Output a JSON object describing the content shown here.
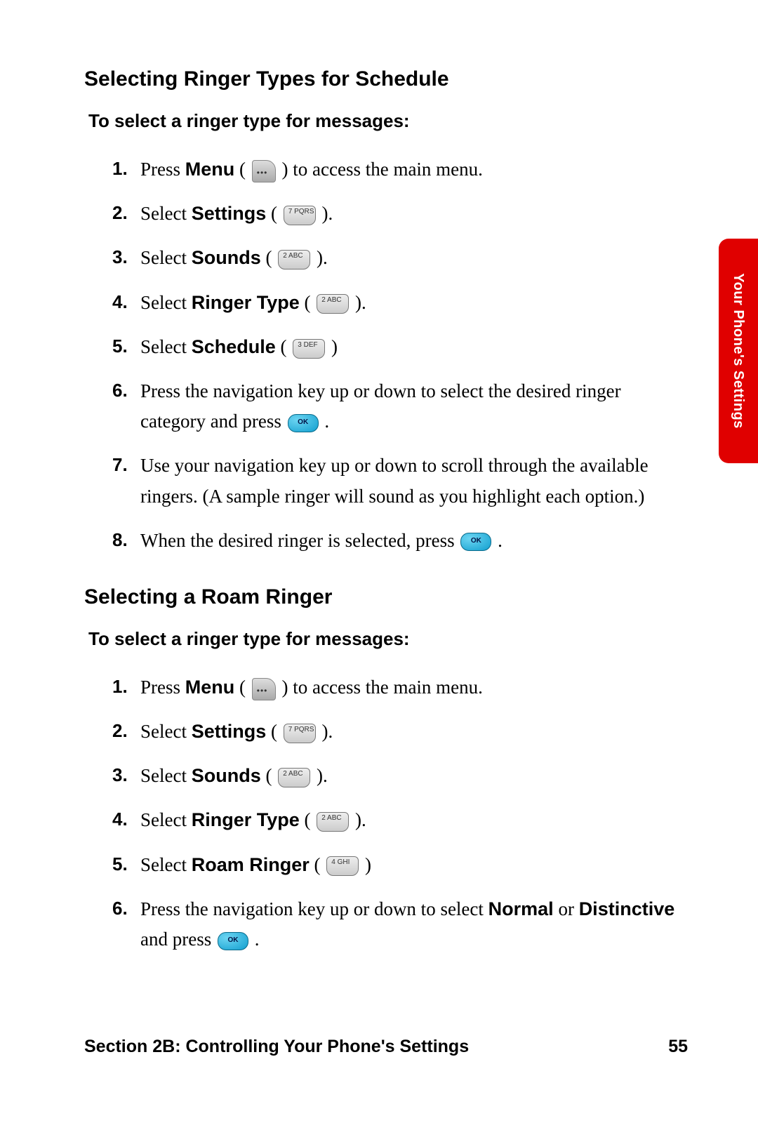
{
  "side_tab": "Your Phone's Settings",
  "section_a": {
    "heading": "Selecting Ringer Types for Schedule",
    "subhead": "To select a ringer type for messages:",
    "steps": {
      "s1_a": "Press ",
      "s1_bold": "Menu",
      "s1_b": " ( ",
      "s1_c": " ) to access the main menu.",
      "s2_a": "Select ",
      "s2_bold": "Settings",
      "s2_b": " ( ",
      "s2_c": " ).",
      "s3_a": "Select ",
      "s3_bold": "Sounds",
      "s3_b": " ( ",
      "s3_c": " ).",
      "s4_a": "Select ",
      "s4_bold": "Ringer Type",
      "s4_b": " ( ",
      "s4_c": " ).",
      "s5_a": "Select ",
      "s5_bold": "Schedule",
      "s5_b": " ( ",
      "s5_c": " )",
      "s6_a": "Press the navigation key up or down to select the desired ringer category and press ",
      "s6_b": " .",
      "s7": "Use your navigation key up or down to scroll through the available ringers. (A sample ringer will sound as you highlight each option.)",
      "s8_a": "When the desired ringer is selected, press ",
      "s8_b": " ."
    }
  },
  "section_b": {
    "heading": "Selecting a Roam Ringer",
    "subhead": "To select a ringer type for messages:",
    "steps": {
      "s1_a": "Press ",
      "s1_bold": "Menu",
      "s1_b": " ( ",
      "s1_c": " ) to access the main menu.",
      "s2_a": "Select ",
      "s2_bold": "Settings",
      "s2_b": " ( ",
      "s2_c": " ).",
      "s3_a": "Select ",
      "s3_bold": "Sounds",
      "s3_b": " ( ",
      "s3_c": " ).",
      "s4_a": "Select ",
      "s4_bold": "Ringer Type",
      "s4_b": " ( ",
      "s4_c": " ).",
      "s5_a": "Select ",
      "s5_bold": "Roam Ringer",
      "s5_b": " ( ",
      "s5_c": " )",
      "s6_a": "Press the navigation key up or down to select ",
      "s6_bold1": "Normal",
      "s6_mid": " or ",
      "s6_bold2": "Distinctive",
      "s6_b": " and press ",
      "s6_c": " ."
    }
  },
  "footer": {
    "left": "Section 2B: Controlling Your Phone's Settings",
    "right": "55"
  }
}
